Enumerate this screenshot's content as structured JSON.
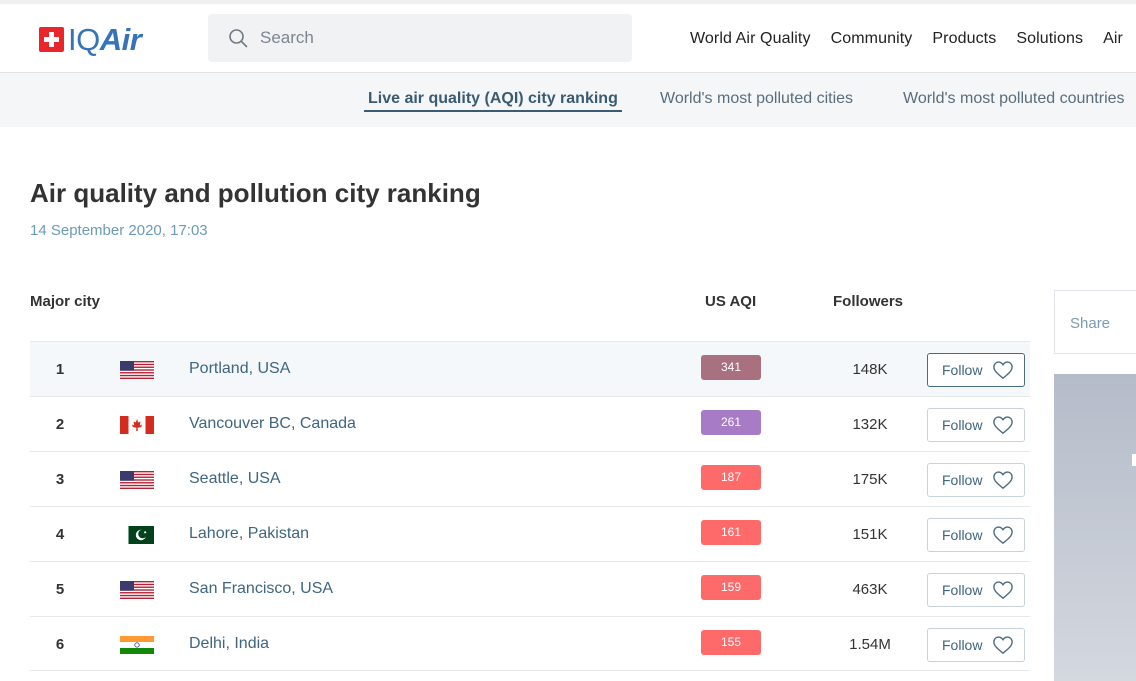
{
  "header": {
    "logo_text_plain": "IQ",
    "logo_text_italic": "Air",
    "search_placeholder": "Search",
    "nav": [
      "World Air Quality",
      "Community",
      "Products",
      "Solutions",
      "Air"
    ]
  },
  "subnav": {
    "items": [
      "Live air quality (AQI) city ranking",
      "World's most polluted cities",
      "World's most polluted countries"
    ],
    "active_index": 0
  },
  "page": {
    "title": "Air quality and pollution city ranking",
    "date": "14 September 2020, 17:03"
  },
  "table": {
    "headers": {
      "city": "Major city",
      "aqi": "US AQI",
      "followers": "Followers"
    },
    "follow_label": "Follow",
    "rows": [
      {
        "rank": "1",
        "country": "usa",
        "city": "Portland, USA",
        "aqi": "341",
        "aqi_color": "#a97080",
        "followers": "148K"
      },
      {
        "rank": "2",
        "country": "canada",
        "city": "Vancouver BC, Canada",
        "aqi": "261",
        "aqi_color": "#a87bc7",
        "followers": "132K"
      },
      {
        "rank": "3",
        "country": "usa",
        "city": "Seattle, USA",
        "aqi": "187",
        "aqi_color": "#fe6a69",
        "followers": "175K"
      },
      {
        "rank": "4",
        "country": "pakistan",
        "city": "Lahore, Pakistan",
        "aqi": "161",
        "aqi_color": "#fe6a69",
        "followers": "151K"
      },
      {
        "rank": "5",
        "country": "usa",
        "city": "San Francisco, USA",
        "aqi": "159",
        "aqi_color": "#fe6a69",
        "followers": "463K"
      },
      {
        "rank": "6",
        "country": "india",
        "city": "Delhi, India",
        "aqi": "155",
        "aqi_color": "#fe6a69",
        "followers": "1.54M"
      }
    ]
  },
  "sidebar": {
    "share_label": "Share"
  },
  "icons": {
    "search": "search-icon",
    "heart": "heart-icon",
    "logo": "swiss-flag-icon"
  }
}
